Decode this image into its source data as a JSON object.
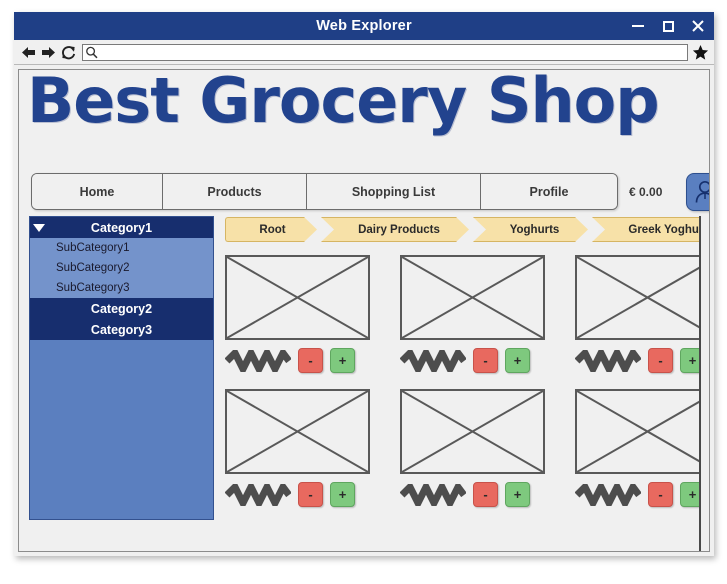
{
  "window": {
    "title": "Web Explorer",
    "controls": {
      "minimize": "minimize",
      "maximize": "maximize",
      "close": "close"
    }
  },
  "toolbar": {
    "back_label": "back",
    "forward_label": "forward",
    "reload_label": "reload",
    "url_value": "",
    "url_placeholder": "",
    "bookmark_label": "bookmark"
  },
  "site": {
    "logo_text": "Best Grocery Shop"
  },
  "nav": {
    "items": [
      {
        "label": "Home"
      },
      {
        "label": "Products"
      },
      {
        "label": "Shopping List"
      },
      {
        "label": "Profile"
      }
    ],
    "cart_total": "€ 0.00",
    "avatar_label": "user-account"
  },
  "sidebar": {
    "nodes": [
      {
        "label": "Category1",
        "type": "category",
        "expanded": true,
        "selected": true
      },
      {
        "label": "SubCategory1",
        "type": "subcategory"
      },
      {
        "label": "SubCategory2",
        "type": "subcategory"
      },
      {
        "label": "SubCategory3",
        "type": "subcategory"
      },
      {
        "label": "Category2",
        "type": "category",
        "expanded": false
      },
      {
        "label": "Category3",
        "type": "category",
        "expanded": false
      }
    ]
  },
  "breadcrumb": {
    "items": [
      {
        "label": "Root"
      },
      {
        "label": "Dairy Products"
      },
      {
        "label": "Yoghurts"
      },
      {
        "label": "Greek Yoghurts"
      }
    ]
  },
  "products": {
    "rows": [
      {
        "cards": [
          {
            "image_alt": "product-image-placeholder",
            "name_placeholder": "product-name-scribble",
            "minus": "-",
            "plus": "+"
          },
          {
            "image_alt": "product-image-placeholder",
            "name_placeholder": "product-name-scribble",
            "minus": "-",
            "plus": "+"
          },
          {
            "image_alt": "product-image-placeholder",
            "name_placeholder": "product-name-scribble",
            "minus": "-",
            "plus": "+"
          }
        ]
      },
      {
        "cards": [
          {
            "image_alt": "product-image-placeholder",
            "name_placeholder": "product-name-scribble",
            "minus": "-",
            "plus": "+"
          },
          {
            "image_alt": "product-image-placeholder",
            "name_placeholder": "product-name-scribble",
            "minus": "-",
            "plus": "+"
          },
          {
            "image_alt": "product-image-placeholder",
            "name_placeholder": "product-name-scribble",
            "minus": "-",
            "plus": "+"
          }
        ]
      }
    ]
  },
  "colors": {
    "titlebar": "#1f3f86",
    "logo": "#22438e",
    "sidebar_bg": "#5b7fbf",
    "sidebar_selected": "#172e6e",
    "sidebar_subitem": "#7493cb",
    "breadcrumb": "#f7e1a8",
    "minus_button": "#e8695f",
    "plus_button": "#7ec97e",
    "avatar": "#5a7fc0"
  }
}
